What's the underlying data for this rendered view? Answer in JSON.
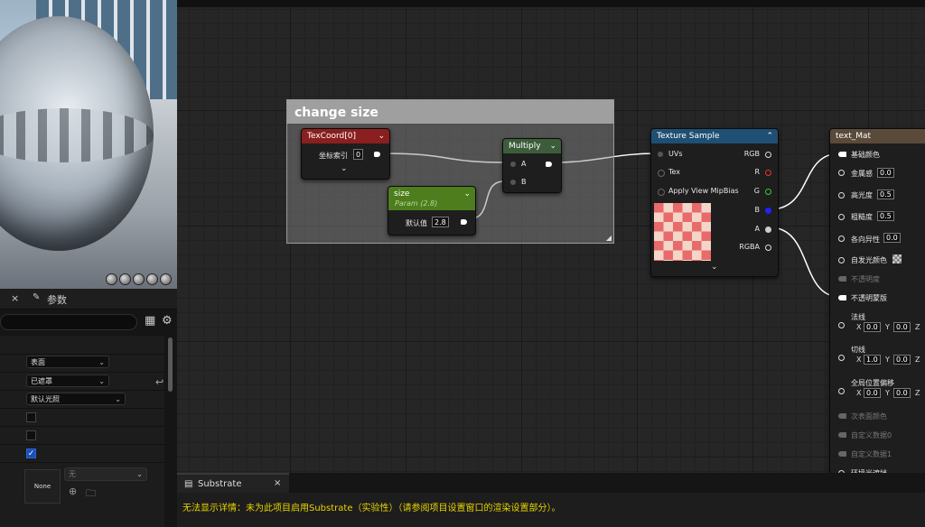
{
  "viewport": {},
  "details": {
    "tab_close": "×",
    "tab_label": "参数",
    "blend_mode": "表面",
    "shading": "已遮罩",
    "lighting": "默认光照",
    "texture_label": "None",
    "texture_combo": "无",
    "checkbox_checked": true
  },
  "comment": {
    "title": "change size"
  },
  "texcoord": {
    "title": "TexCoord[0]",
    "index_label": "坐标索引",
    "index_value": "0"
  },
  "size_param": {
    "title": "size",
    "subtitle": "Param (2.8)",
    "default_label": "默认值",
    "default_value": "2.8"
  },
  "multiply": {
    "title": "Multiply",
    "in_a": "A",
    "in_b": "B"
  },
  "texture_sample": {
    "title": "Texture Sample",
    "in_uvs": "UVs",
    "in_tex": "Tex",
    "in_mip": "Apply View MipBias",
    "out_rgb": "RGB",
    "out_r": "R",
    "out_g": "G",
    "out_b": "B",
    "out_a": "A",
    "out_rgba": "RGBA"
  },
  "material": {
    "title": "text_Mat",
    "base_color": "基础颜色",
    "metallic": "金属感",
    "metallic_value": "0.0",
    "specular": "高光度",
    "specular_value": "0.5",
    "roughness": "粗糙度",
    "roughness_value": "0.5",
    "anisotropy": "各向异性",
    "anisotropy_value": "0.0",
    "emissive": "自发光颜色",
    "opacity": "不透明度",
    "opacity_mask": "不透明蒙版",
    "normal": "法线",
    "normal_x": "0.0",
    "normal_y": "0.0",
    "tangent": "切线",
    "tangent_x": "1.0",
    "tangent_y": "0.0",
    "wpo": "全局位置偏移",
    "wpo_x": "0.0",
    "wpo_y": "0.0",
    "x": "X",
    "y": "Y",
    "z": "Z",
    "subsurface": "次表面颜色",
    "custom0": "自定义数据0",
    "custom1": "自定义数据1",
    "ao": "环境光遮挡"
  },
  "substrate": {
    "tab_label": "Substrate",
    "tab_close": "×",
    "message": "无法显示详情：未为此项目启用Substrate（实验性）（请参阅项目设置窗口的渲染设置部分）。"
  },
  "colors": {
    "texcoord_header": "#8a1f1f",
    "param_header": "#4e7d1d",
    "multiply_header": "#3d5d3a",
    "texsample_header": "#1f4f73",
    "material_header": "#5a4a3a",
    "warning": "#e8d400"
  }
}
